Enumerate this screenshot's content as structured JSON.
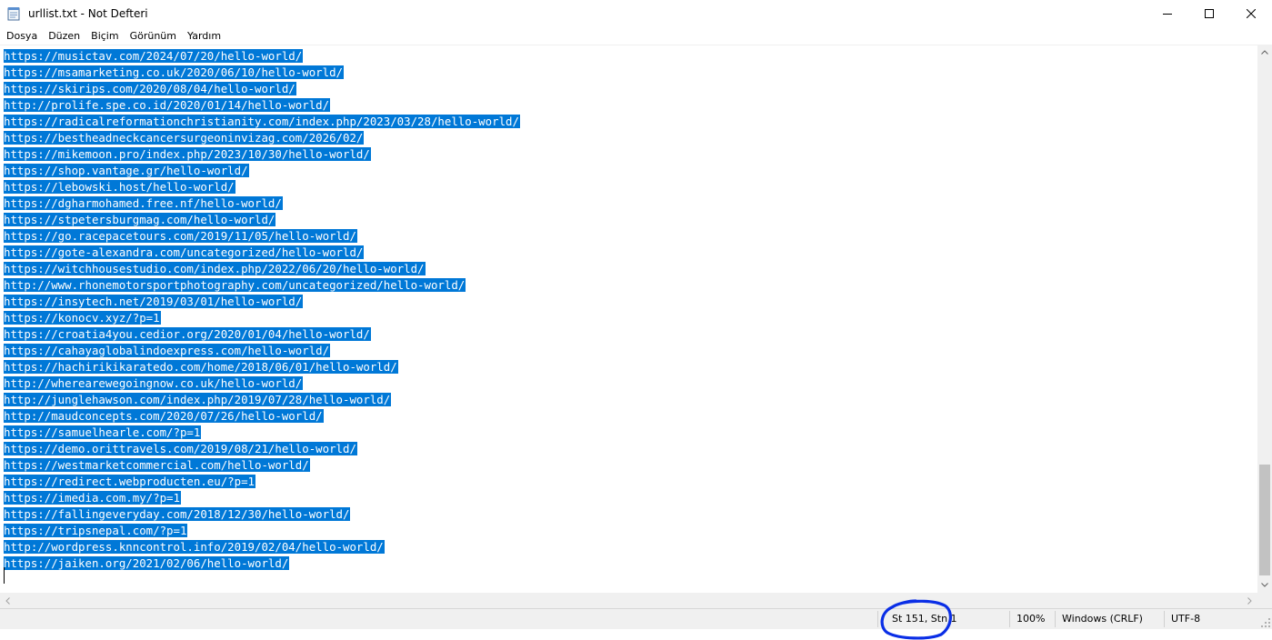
{
  "window": {
    "title": "urllist.txt - Not Defteri",
    "icon": "notepad-icon",
    "controls": [
      "minimize-icon",
      "maximize-icon",
      "close-icon"
    ]
  },
  "menu": [
    "Dosya",
    "Düzen",
    "Biçim",
    "Görünüm",
    "Yardım"
  ],
  "editor": {
    "selection_color": "#0078d7",
    "lines": [
      "https://musictav.com/2024/07/20/hello-world/",
      "https://msamarketing.co.uk/2020/06/10/hello-world/",
      "https://skirips.com/2020/08/04/hello-world/",
      "http://prolife.spe.co.id/2020/01/14/hello-world/",
      "https://radicalreformationchristianity.com/index.php/2023/03/28/hello-world/",
      "https://bestheadneckcancersurgeoninvizag.com/2026/02/",
      "https://mikemoon.pro/index.php/2023/10/30/hello-world/",
      "https://shop.vantage.gr/hello-world/",
      "https://lebowski.host/hello-world/",
      "https://dgharmohamed.free.nf/hello-world/",
      "https://stpetersburgmag.com/hello-world/",
      "https://go.racepacetours.com/2019/11/05/hello-world/",
      "https://gote-alexandra.com/uncategorized/hello-world/",
      "https://witchhousestudio.com/index.php/2022/06/20/hello-world/",
      "http://www.rhonemotorsportphotography.com/uncategorized/hello-world/",
      "https://insytech.net/2019/03/01/hello-world/",
      "https://konocv.xyz/?p=1",
      "https://croatia4you.cedior.org/2020/01/04/hello-world/",
      "https://cahayaglobalindoexpress.com/hello-world/",
      "https://hachirikikaratedo.com/home/2018/06/01/hello-world/",
      "http://wherearewegoingnow.co.uk/hello-world/",
      "http://junglehawson.com/index.php/2019/07/28/hello-world/",
      "http://maudconcepts.com/2020/07/26/hello-world/",
      "https://samuelhearle.com/?p=1",
      "https://demo.orittravels.com/2019/08/21/hello-world/",
      "https://westmarketcommercial.com/hello-world/",
      "https://redirect.webproducten.eu/?p=1",
      "https://imedia.com.my/?p=1",
      "https://fallingeveryday.com/2018/12/30/hello-world/",
      "https://tripsnepal.com/?p=1",
      "http://wordpress.knncontrol.info/2019/02/04/hello-world/",
      "https://jaiken.org/2021/02/06/hello-world/"
    ]
  },
  "status": {
    "position": "St 151, Stn 1",
    "zoom": "100%",
    "line_ending": "Windows (CRLF)",
    "encoding": "UTF-8"
  },
  "annotation": {
    "color": "#0a2ee6",
    "shape": "ellipse"
  }
}
